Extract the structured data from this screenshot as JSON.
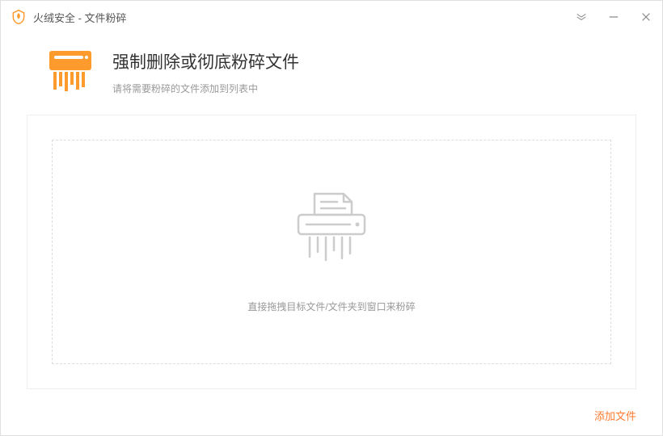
{
  "titlebar": {
    "app_name": "火绒安全 - 文件粉碎"
  },
  "header": {
    "title": "强制删除或彻底粉碎文件",
    "subtitle": "请将需要粉碎的文件添加到列表中"
  },
  "dropzone": {
    "hint": "直接拖拽目标文件/文件夹到窗口来粉碎"
  },
  "footer": {
    "add_file": "添加文件"
  },
  "colors": {
    "accent": "#ff7a2d",
    "orange": "#ff9b2d"
  }
}
